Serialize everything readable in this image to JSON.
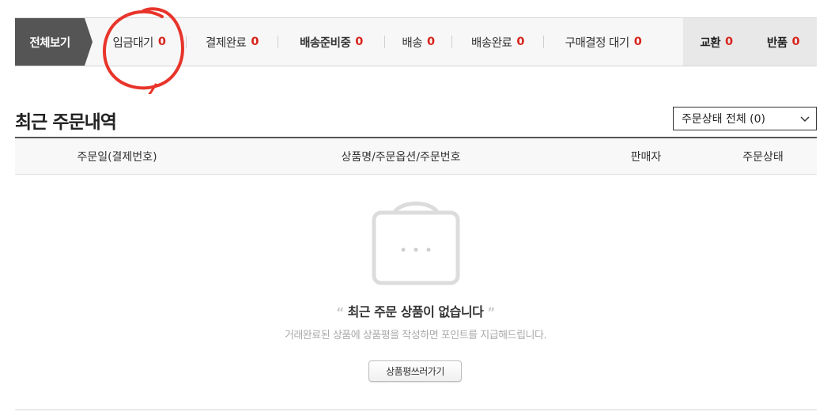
{
  "status_tabs": {
    "all_label": "전체보기",
    "items": [
      {
        "label": "입금대기",
        "count": "0"
      },
      {
        "label": "결제완료",
        "count": "0"
      },
      {
        "label": "배송준비중",
        "count": "0"
      },
      {
        "label": "배송",
        "count": "0"
      },
      {
        "label": "배송완료",
        "count": "0"
      },
      {
        "label": "구매결정 대기",
        "count": "0"
      }
    ],
    "extra": [
      {
        "label": "교환",
        "count": "0"
      },
      {
        "label": "반품",
        "count": "0"
      }
    ]
  },
  "section": {
    "title": "최근 주문내역",
    "filter_selected": "주문상태 전체 (0)"
  },
  "table": {
    "columns": [
      "주문일(결제번호)",
      "상품명/주문옵션/주문번호",
      "판매자",
      "주문상태"
    ]
  },
  "empty_state": {
    "quote_open": "“",
    "title": "최근 주문 상품이 없습니다",
    "quote_close": "”",
    "description": "거래완료된 상품에 상품평을 작성하면 포인트를 지급해드립니다.",
    "button_label": "상품평쓰러가기",
    "icon": "shopping-bag-icon"
  },
  "colors": {
    "count_red": "#d9241b",
    "annotation_red": "#e8342a",
    "active_tab": "#555555"
  }
}
